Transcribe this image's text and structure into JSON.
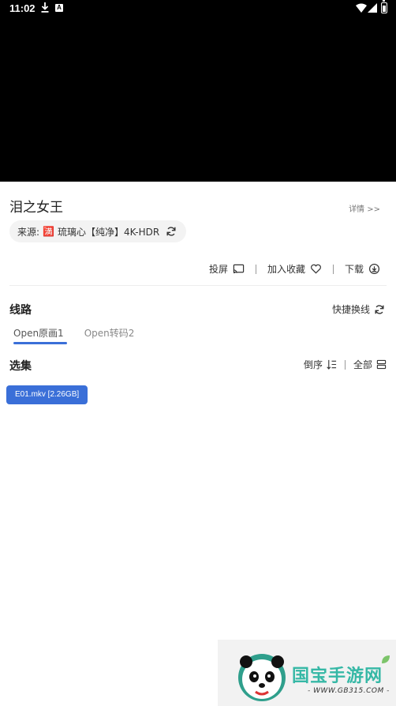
{
  "status_bar": {
    "time": "11:02",
    "icons": [
      "download-icon",
      "a-icon",
      "wifi-icon",
      "signal-icon",
      "battery-icon"
    ],
    "a_glyph": "A"
  },
  "video": {
    "background": "#000000"
  },
  "title": "泪之女王",
  "detail_link": "详情 >>",
  "source": {
    "prefix": "来源:",
    "flag": "🈵",
    "name": "琉璃心【纯净】4K-HDR",
    "refresh_icon": "refresh-icon"
  },
  "actions": {
    "cast": {
      "label": "投屏",
      "icon": "cast-icon"
    },
    "favorite": {
      "label": "加入收藏",
      "icon": "heart-icon"
    },
    "download": {
      "label": "下载",
      "icon": "download-circle-icon"
    }
  },
  "lines": {
    "label": "线路",
    "quick_switch": "快捷换线",
    "tabs": [
      {
        "label": "Open原画1",
        "active": true
      },
      {
        "label": "Open转码2",
        "active": false
      }
    ]
  },
  "episodes": {
    "label": "选集",
    "sort_label": "倒序",
    "all_label": "全部",
    "items": [
      "E01.mkv [2.26GB]"
    ]
  },
  "watermark": {
    "brand": "国宝手游网",
    "url": "- WWW.GB315.COM -"
  },
  "colors": {
    "accent": "#3a6fd8",
    "watermark_green": "#36b8a6"
  }
}
